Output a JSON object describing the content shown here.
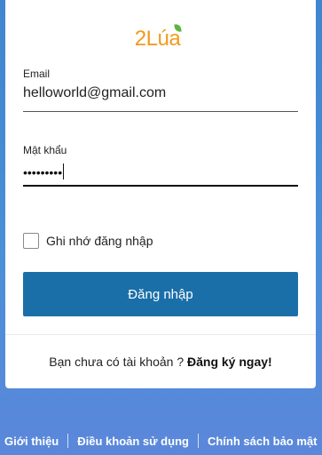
{
  "logo": {
    "text": "2Lúa"
  },
  "form": {
    "email_label": "Email",
    "email_value": "helloworld@gmail.com",
    "password_label": "Mật khẩu",
    "password_value": "•••••••••",
    "remember_label": "Ghi nhớ đăng nhập",
    "remember_checked": false,
    "login_button": "Đăng nhập"
  },
  "signup": {
    "prompt": "Bạn chưa có tài khoản ?",
    "link": "Đăng ký ngay!"
  },
  "footer": {
    "links": [
      "Giới thiệu",
      "Điều khoản sử dụng",
      "Chính sách bảo mật"
    ]
  },
  "colors": {
    "logo": "#f29a1d",
    "logo_leaf": "#5cb63b",
    "button": "#1a6fa8",
    "background": "#4a8fd8"
  }
}
